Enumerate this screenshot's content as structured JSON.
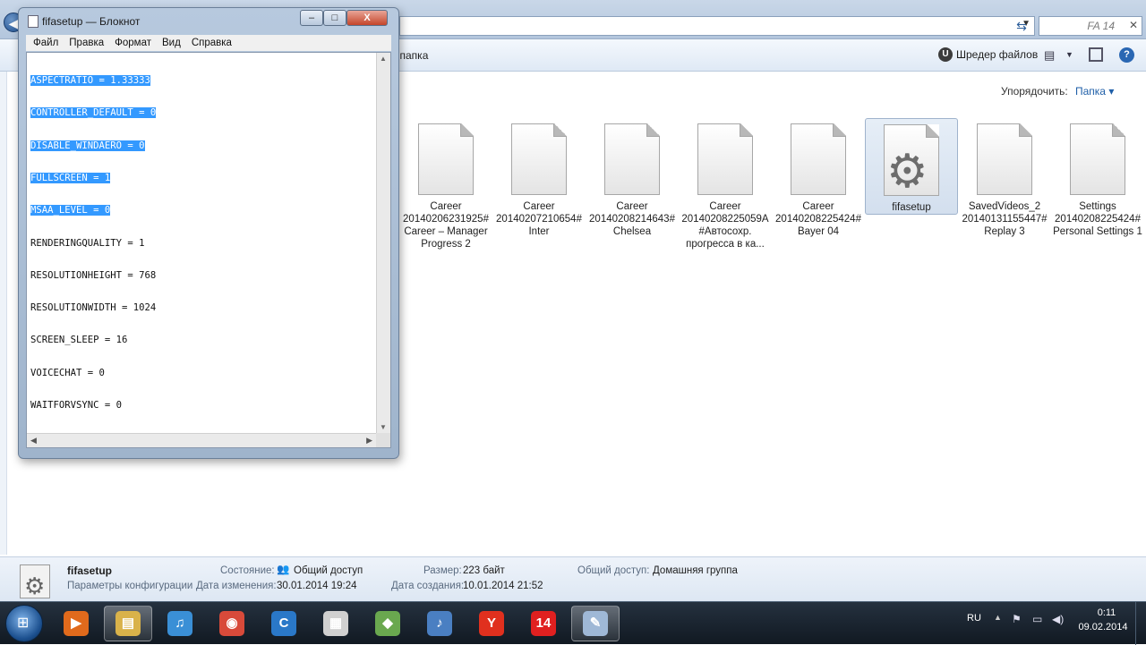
{
  "explorer": {
    "search_text": "FA 14",
    "toolbar": {
      "new_folder": "ая папка",
      "shredder": "Шредер файлов",
      "help": "?"
    },
    "arrange_label": "Упорядочить:",
    "arrange_value": "Папка",
    "files": [
      {
        "label": "Career 20140206231925# Career – Manager Progress 2"
      },
      {
        "label": "Career 20140207210654# Inter"
      },
      {
        "label": "Career 20140208214643# Chelsea"
      },
      {
        "label": "Career 20140208225059A #Автосохр. прогресса в ка..."
      },
      {
        "label": "Career 20140208225424# Bayer 04"
      },
      {
        "label": "fifasetup",
        "selected": true,
        "icon": "gear-settings-file"
      },
      {
        "label": "SavedVideos_2 20140131155447# Replay 3"
      },
      {
        "label": "Settings 20140208225424# Personal Settings 1"
      }
    ],
    "details": {
      "name": "fifasetup",
      "type": "Параметры конфигурации",
      "state_key": "Состояние:",
      "state_val": "Общий доступ",
      "modified_key": "Дата изменения:",
      "modified_val": "30.01.2014 19:24",
      "size_key": "Размер:",
      "size_val": "223 байт",
      "created_key": "Дата создания:",
      "created_val": "10.01.2014 21:52",
      "shared_key": "Общий доступ:",
      "shared_val": "Домашняя группа"
    }
  },
  "notepad": {
    "title": "fifasetup — Блокнот",
    "controls": {
      "minimize": "–",
      "maximize": "□",
      "close": "X"
    },
    "menu": [
      "Файл",
      "Правка",
      "Формат",
      "Вид",
      "Справка"
    ],
    "lines": [
      {
        "text": "ASPECTRATIO = 1.33333",
        "selected": true
      },
      {
        "text": "CONTROLLER_DEFAULT = 0",
        "selected": true
      },
      {
        "text": "DISABLE_WINDAERO = 0",
        "selected": true
      },
      {
        "text": "FULLSCREEN = 1",
        "selected": true
      },
      {
        "text": "MSAA_LEVEL = 0",
        "selected": true
      },
      {
        "text": "RENDERINGQUALITY = 1",
        "selected": false
      },
      {
        "text": "RESOLUTIONHEIGHT = 768",
        "selected": false
      },
      {
        "text": "RESOLUTIONWIDTH = 1024",
        "selected": false
      },
      {
        "text": "SCREEN_SLEEP = 16",
        "selected": false
      },
      {
        "text": "VOICECHAT = 0",
        "selected": false
      },
      {
        "text": "WAITFORVSYNC = 0",
        "selected": false
      }
    ]
  },
  "taskbar": {
    "items": [
      {
        "name": "media-player",
        "glyph": "▶",
        "color": "#e06a1c"
      },
      {
        "name": "explorer-folder",
        "glyph": "▤",
        "color": "#d9b24a",
        "active": true
      },
      {
        "name": "music-app",
        "glyph": "♫",
        "color": "#3a8fd6"
      },
      {
        "name": "chrome-browser",
        "glyph": "◉",
        "color": "#d84a3a"
      },
      {
        "name": "ccleaner",
        "glyph": "C",
        "color": "#2a78c8"
      },
      {
        "name": "document-viewer",
        "glyph": "▦",
        "color": "#d0d0d0"
      },
      {
        "name": "android-app",
        "glyph": "◆",
        "color": "#6aa84f"
      },
      {
        "name": "itunes",
        "glyph": "♪",
        "color": "#4a7fc2"
      },
      {
        "name": "yandex-browser",
        "glyph": "Y",
        "color": "#e0301e"
      },
      {
        "name": "fifa-14-game",
        "glyph": "14",
        "color": "#e02020"
      },
      {
        "name": "notepad",
        "glyph": "✎",
        "color": "#9fb8d6",
        "active": true
      }
    ],
    "tray": {
      "lang": "RU",
      "time": "0:11",
      "date": "09.02.2014"
    }
  }
}
